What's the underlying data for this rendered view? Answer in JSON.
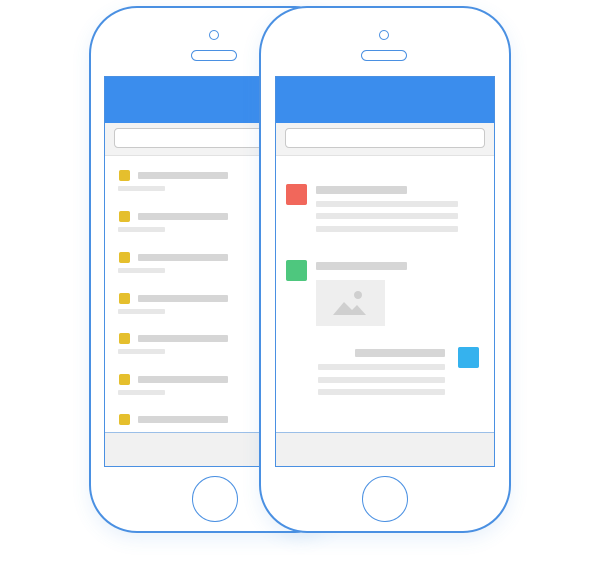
{
  "colors": {
    "phone_outline": "#4a90e2",
    "app_header": "#3b8ded",
    "list_item_marker": "#e5bf2d",
    "message_red": "#f1675b",
    "message_green": "#4ec77e",
    "message_blue": "#35b2ee",
    "placeholder_bar": "#dedede",
    "search_bar_bg": "#f3f3f3",
    "bottom_bar_bg": "#f1f1f1"
  },
  "left_phone": {
    "screen": "list-view",
    "search": {
      "value": "",
      "placeholder": ""
    },
    "list_items": [
      {
        "marker_icon": "yellow-square-icon"
      },
      {
        "marker_icon": "yellow-square-icon"
      },
      {
        "marker_icon": "yellow-square-icon"
      },
      {
        "marker_icon": "yellow-square-icon"
      },
      {
        "marker_icon": "yellow-square-icon"
      },
      {
        "marker_icon": "yellow-square-icon"
      },
      {
        "marker_icon": "yellow-square-icon"
      }
    ]
  },
  "right_phone": {
    "screen": "chat-view",
    "search": {
      "value": "",
      "placeholder": ""
    },
    "messages": [
      {
        "avatar_icon": "red-square-avatar-icon",
        "alignment": "left",
        "content": "text"
      },
      {
        "avatar_icon": "green-square-avatar-icon",
        "alignment": "left",
        "content": "image"
      },
      {
        "avatar_icon": "blue-square-avatar-icon",
        "alignment": "right",
        "content": "text"
      }
    ],
    "image_icon": "mountain-image-icon"
  }
}
